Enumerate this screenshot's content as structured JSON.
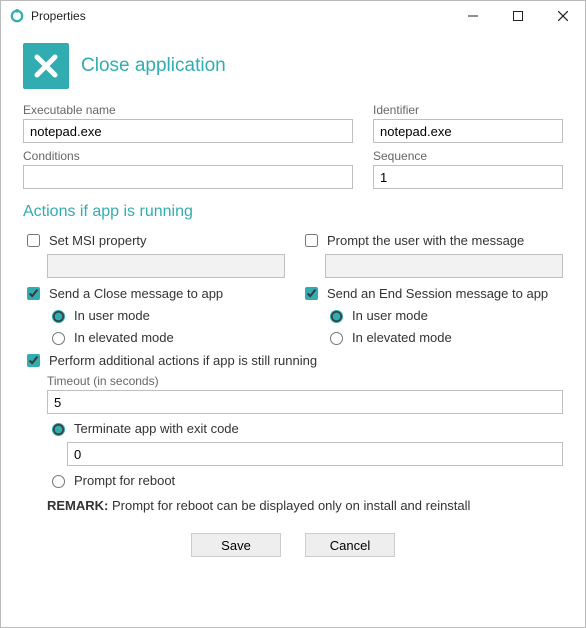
{
  "window": {
    "title": "Properties"
  },
  "header": {
    "title": "Close application"
  },
  "fields": {
    "exec_label": "Executable name",
    "exec_value": "notepad.exe",
    "ident_label": "Identifier",
    "ident_value": "notepad.exe",
    "cond_label": "Conditions",
    "cond_value": "",
    "seq_label": "Sequence",
    "seq_value": "1"
  },
  "actions": {
    "section_title": "Actions if app is running",
    "set_msi_label": "Set MSI property",
    "set_msi_checked": false,
    "set_msi_value": "",
    "prompt_user_label": "Prompt the user with the message",
    "prompt_user_checked": false,
    "prompt_user_value": "",
    "send_close_label": "Send a Close message to app",
    "send_close_checked": true,
    "send_end_label": "Send an End Session message to app",
    "send_end_checked": true,
    "mode_user": "In user mode",
    "mode_elev": "In elevated mode",
    "perform_additional_label": "Perform additional actions if app is still running",
    "perform_additional_checked": true,
    "timeout_label": "Timeout (in seconds)",
    "timeout_value": "5",
    "terminate_label": "Terminate app with exit code",
    "terminate_value": "0",
    "prompt_reboot_label": "Prompt for reboot",
    "remark_prefix": "REMARK:",
    "remark_text": " Prompt for reboot can be displayed only on install and reinstall"
  },
  "buttons": {
    "save": "Save",
    "cancel": "Cancel"
  }
}
